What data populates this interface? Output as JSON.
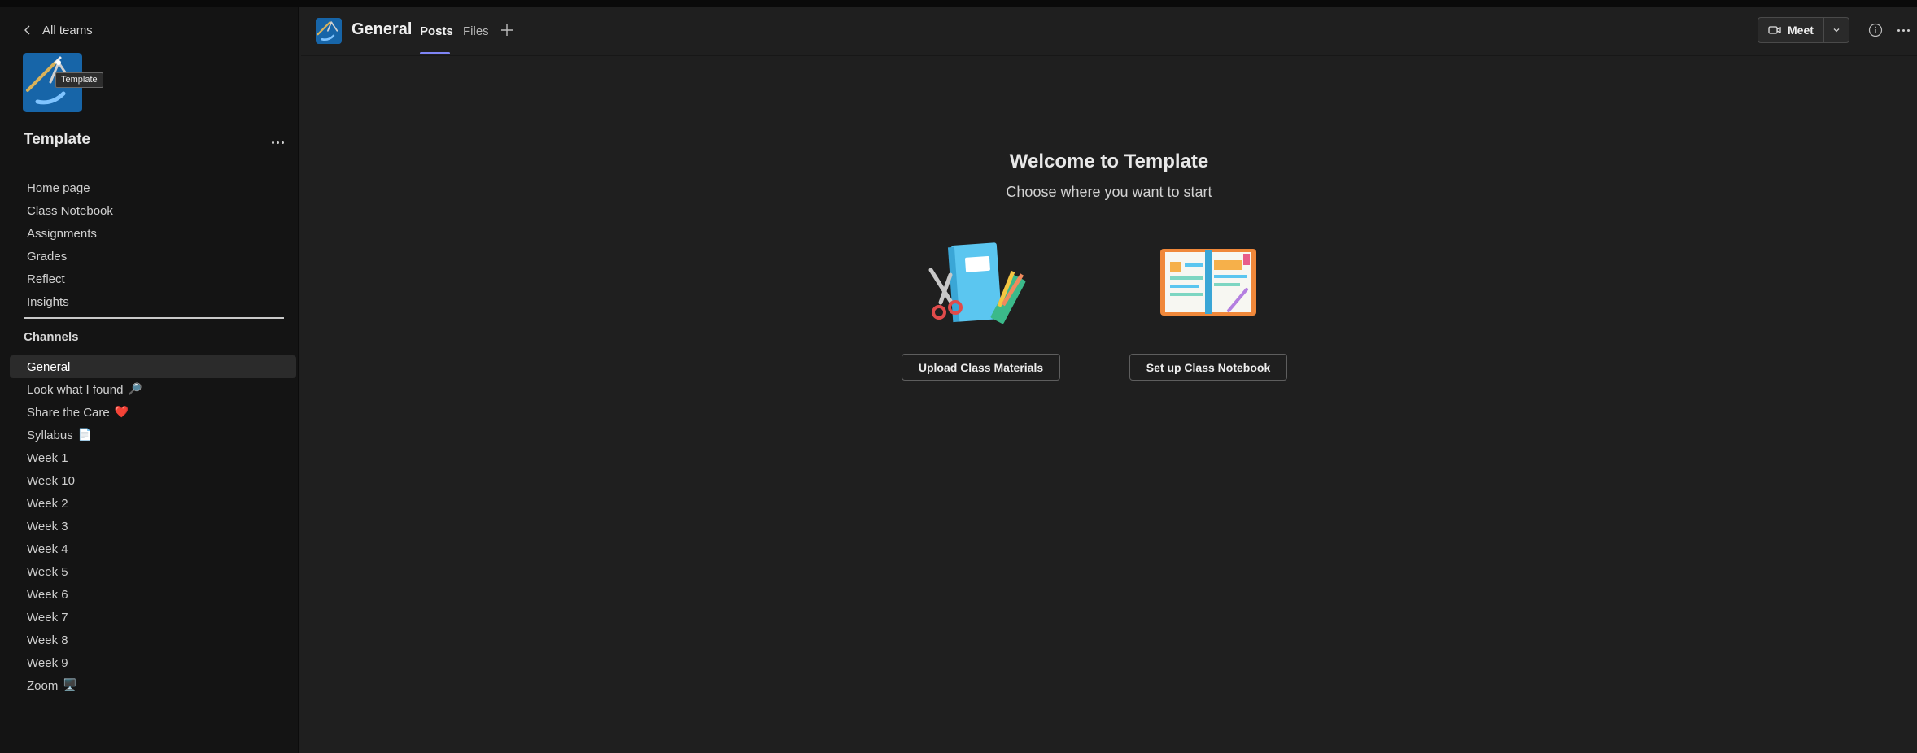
{
  "sidebar": {
    "back_label": "All teams",
    "tooltip": "Template",
    "team_name": "Template",
    "nav_items": [
      {
        "label": "Home page"
      },
      {
        "label": "Class Notebook"
      },
      {
        "label": "Assignments"
      },
      {
        "label": "Grades"
      },
      {
        "label": "Reflect"
      },
      {
        "label": "Insights"
      }
    ],
    "channels_title": "Channels",
    "channels": [
      {
        "label": "General",
        "emoji": "",
        "active": true
      },
      {
        "label": "Look what I found",
        "emoji": "🔎"
      },
      {
        "label": "Share the Care",
        "emoji": "❤️"
      },
      {
        "label": "Syllabus",
        "emoji": "📄"
      },
      {
        "label": "Week 1",
        "emoji": ""
      },
      {
        "label": "Week 10",
        "emoji": ""
      },
      {
        "label": "Week 2",
        "emoji": ""
      },
      {
        "label": "Week 3",
        "emoji": ""
      },
      {
        "label": "Week 4",
        "emoji": ""
      },
      {
        "label": "Week 5",
        "emoji": ""
      },
      {
        "label": "Week 6",
        "emoji": ""
      },
      {
        "label": "Week 7",
        "emoji": ""
      },
      {
        "label": "Week 8",
        "emoji": ""
      },
      {
        "label": "Week 9",
        "emoji": ""
      },
      {
        "label": "Zoom",
        "emoji": "🖥️"
      }
    ]
  },
  "header": {
    "channel_title": "General",
    "tabs": [
      {
        "label": "Posts",
        "active": true
      },
      {
        "label": "Files",
        "active": false
      }
    ],
    "meet_label": "Meet"
  },
  "main": {
    "welcome_title": "Welcome to Template",
    "welcome_subtitle": "Choose where you want to start",
    "upload_button": "Upload Class Materials",
    "notebook_button": "Set up Class Notebook"
  },
  "colors": {
    "accent": "#7f85f5",
    "team_avatar_bg": "#1765a8",
    "sidebar_bg": "#141414",
    "main_bg": "#1f1f1f"
  },
  "icons": [
    "chevron-left-icon",
    "more-icon",
    "add-tab-icon",
    "video-camera-icon",
    "chevron-down-icon",
    "info-icon"
  ]
}
